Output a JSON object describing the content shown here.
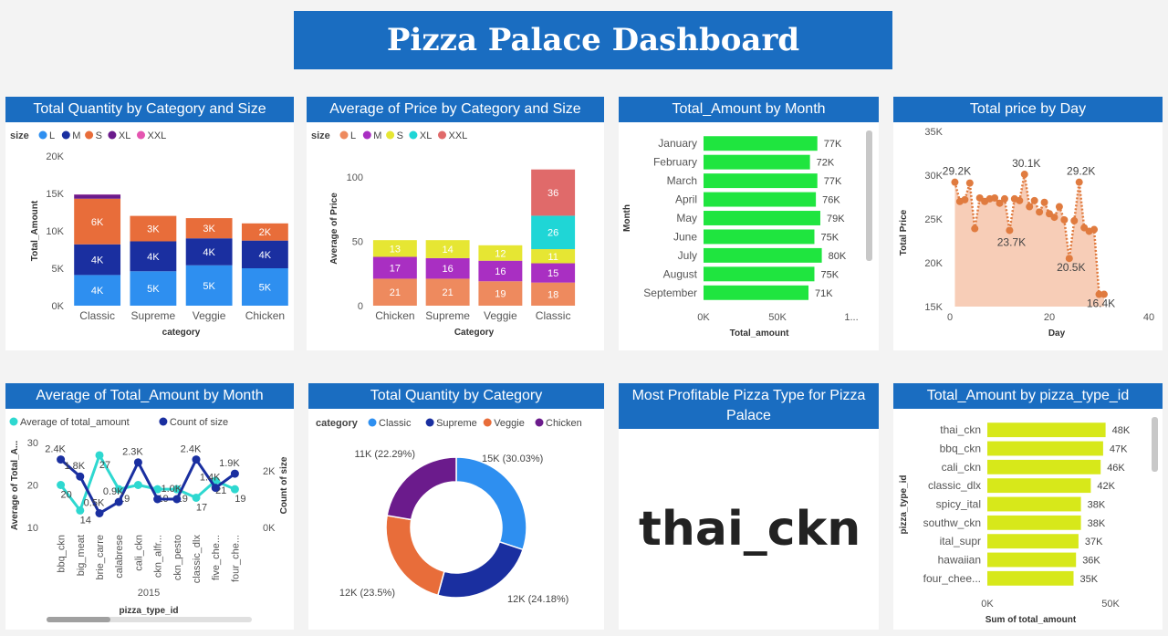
{
  "dashboard": {
    "title": "Pizza Palace Dashboard"
  },
  "panels": {
    "qty_cat_size": "Total Quantity by Category and Size",
    "avg_price": "Average of Price by Category and Size",
    "amount_month": "Total_Amount by Month",
    "price_day": "Total price by Day",
    "avg_amount_month": "Average of Total_Amount by Month",
    "qty_category": "Total Quantity by Category",
    "profitable": "Most Profitable Pizza Type for Pizza Palace",
    "amount_type": "Total_Amount by pizza_type_id"
  },
  "kpi": {
    "value": "thai_ckn"
  },
  "colors": {
    "header": "#1a6dc1"
  },
  "chart_data": [
    {
      "id": "c1",
      "type": "bar",
      "stacked": true,
      "categories": [
        "Classic",
        "Supreme",
        "Veggie",
        "Chicken"
      ],
      "xlabel": "category",
      "ylabel": "Total_Amount",
      "legend_title": "size",
      "ylim": [
        0,
        20000
      ],
      "yticks": [
        {
          "v": 0,
          "t": "0K"
        },
        {
          "v": 5000,
          "t": "5K"
        },
        {
          "v": 10000,
          "t": "10K"
        },
        {
          "v": 15000,
          "t": "15K"
        },
        {
          "v": 20000,
          "t": "20K"
        }
      ],
      "series": [
        {
          "name": "L",
          "color": "#2e8ff0",
          "values": [
            4100,
            4600,
            5400,
            5000
          ],
          "labels": [
            "4K",
            "5K",
            "5K",
            "5K"
          ]
        },
        {
          "name": "M",
          "color": "#1a2fa0",
          "values": [
            4100,
            4000,
            3600,
            3700
          ],
          "labels": [
            "4K",
            "4K",
            "4K",
            "4K"
          ]
        },
        {
          "name": "S",
          "color": "#e86d3a",
          "values": [
            6100,
            3400,
            2700,
            2300
          ],
          "labels": [
            "6K",
            "3K",
            "3K",
            "2K"
          ]
        },
        {
          "name": "XL",
          "color": "#6b1b8c",
          "values": [
            550,
            0,
            0,
            0
          ],
          "labels": [
            "",
            "",
            "",
            ""
          ]
        },
        {
          "name": "XXL",
          "color": "#e455b0",
          "values": [
            30,
            0,
            0,
            0
          ],
          "labels": [
            "",
            "",
            "",
            ""
          ]
        }
      ]
    },
    {
      "id": "c2",
      "type": "bar",
      "stacked": true,
      "categories": [
        "Chicken",
        "Supreme",
        "Veggie",
        "Classic"
      ],
      "xlabel": "Category",
      "ylabel": "Average of Price",
      "legend_title": "size",
      "ylim": [
        0,
        120
      ],
      "yticks": [
        {
          "v": 0,
          "t": "0"
        },
        {
          "v": 50,
          "t": "50"
        },
        {
          "v": 100,
          "t": "100"
        }
      ],
      "series": [
        {
          "name": "L",
          "color": "#ee8a5e",
          "values": [
            21,
            21,
            19,
            18
          ],
          "labels": [
            "21",
            "21",
            "19",
            "18"
          ]
        },
        {
          "name": "M",
          "color": "#a92fc2",
          "values": [
            17,
            16,
            16,
            15
          ],
          "labels": [
            "17",
            "16",
            "16",
            "15"
          ]
        },
        {
          "name": "S",
          "color": "#e6e633",
          "values": [
            13,
            14,
            12,
            11
          ],
          "labels": [
            "13",
            "14",
            "12",
            "11"
          ]
        },
        {
          "name": "XL",
          "color": "#1fd6d6",
          "values": [
            0,
            0,
            0,
            26
          ],
          "labels": [
            "",
            "",
            "",
            "26"
          ]
        },
        {
          "name": "XXL",
          "color": "#e06a6a",
          "values": [
            0,
            0,
            0,
            36
          ],
          "labels": [
            "",
            "",
            "",
            "36"
          ]
        }
      ]
    },
    {
      "id": "c3",
      "type": "bar",
      "orientation": "horizontal",
      "categories": [
        "January",
        "February",
        "March",
        "April",
        "May",
        "June",
        "July",
        "August",
        "September"
      ],
      "values": [
        77000,
        72000,
        77000,
        76000,
        79000,
        75000,
        80000,
        75000,
        71000
      ],
      "labels": [
        "77K",
        "72K",
        "77K",
        "76K",
        "79K",
        "75K",
        "80K",
        "75K",
        "71K"
      ],
      "xlabel": "Total_amount",
      "ylabel": "Month",
      "xlim": [
        0,
        100000
      ],
      "xticks": [
        {
          "v": 0,
          "t": "0K"
        },
        {
          "v": 50000,
          "t": "50K"
        },
        {
          "v": 100000,
          "t": "1..."
        }
      ],
      "color": "#1fe53f"
    },
    {
      "id": "c4",
      "type": "area",
      "x": [
        1,
        2,
        3,
        4,
        5,
        6,
        7,
        8,
        9,
        10,
        11,
        12,
        13,
        14,
        15,
        16,
        17,
        18,
        19,
        20,
        21,
        22,
        23,
        24,
        25,
        26,
        27,
        28,
        29,
        30,
        31
      ],
      "y": [
        29200,
        27000,
        27200,
        29100,
        23900,
        27400,
        27000,
        27300,
        27400,
        26800,
        27300,
        23700,
        27300,
        27100,
        30100,
        26400,
        27100,
        25800,
        26900,
        25600,
        25200,
        26400,
        24900,
        20500,
        24800,
        29200,
        24000,
        23600,
        23800,
        16400,
        16400
      ],
      "labels": [
        {
          "i": 0,
          "t": "29.2K"
        },
        {
          "i": 11,
          "t": "23.7K"
        },
        {
          "i": 14,
          "t": "30.1K"
        },
        {
          "i": 23,
          "t": "20.5K"
        },
        {
          "i": 25,
          "t": "29.2K"
        },
        {
          "i": 29,
          "t": "16.4K"
        }
      ],
      "xlabel": "Day",
      "ylabel": "Total Price",
      "xlim": [
        0,
        40
      ],
      "ylim": [
        15000,
        35000
      ],
      "xticks": [
        {
          "v": 0,
          "t": "0"
        },
        {
          "v": 20,
          "t": "20"
        },
        {
          "v": 40,
          "t": "40"
        }
      ],
      "yticks": [
        {
          "v": 15000,
          "t": "15K"
        },
        {
          "v": 20000,
          "t": "20K"
        },
        {
          "v": 25000,
          "t": "25K"
        },
        {
          "v": 30000,
          "t": "30K"
        },
        {
          "v": 35000,
          "t": "35K"
        }
      ],
      "color": "#e07b3f",
      "fill": "#f7cdb7"
    },
    {
      "id": "c5",
      "type": "line",
      "categories": [
        "bbq_ckn",
        "big_meat",
        "brie_carre",
        "calabrese",
        "cali_ckn",
        "ckn_alfr...",
        "ckn_pesto",
        "classic_dlx",
        "five_che...",
        "four_che..."
      ],
      "xlabel": "pizza_type_id",
      "xgroup": "2015",
      "ylabel": "Average of Total_A...",
      "y2label": "Count of size",
      "ylim": [
        10,
        30
      ],
      "y2lim": [
        0,
        3000
      ],
      "yticks": [
        {
          "v": 10,
          "t": "10"
        },
        {
          "v": 20,
          "t": "20"
        },
        {
          "v": 30,
          "t": "30"
        }
      ],
      "y2ticks": [
        {
          "v": 0,
          "t": "0K"
        },
        {
          "v": 2000,
          "t": "2K"
        }
      ],
      "series": [
        {
          "name": "Average of total_amount",
          "color": "#2ed8d0",
          "axis": "y",
          "values": [
            20,
            14,
            27,
            19,
            20,
            19,
            19,
            17,
            21,
            19
          ],
          "labels": [
            "20",
            "14",
            "27",
            "19",
            "",
            "19",
            "19",
            "17",
            "21",
            "19"
          ]
        },
        {
          "name": "Count of size",
          "color": "#1a2fa0",
          "axis": "y2",
          "values": [
            2400,
            1800,
            500,
            900,
            2300,
            1000,
            1000,
            2400,
            1400,
            1900
          ],
          "labels": [
            "2.4K",
            "1.8K",
            "0.5K",
            "0.9K",
            "2.3K",
            "",
            "1.0K",
            "2.4K",
            "1.4K",
            "1.9K"
          ]
        }
      ]
    },
    {
      "id": "c6",
      "type": "pie",
      "donut": true,
      "legend_title": "category",
      "categories": [
        "Classic",
        "Supreme",
        "Veggie",
        "Chicken"
      ],
      "values": [
        15000,
        12000,
        11700,
        11100
      ],
      "labels": [
        "15K (30.03%)",
        "12K (24.18%)",
        "12K (23.5%)",
        "11K (22.29%)"
      ],
      "colors": [
        "#2e8ff0",
        "#1a2fa0",
        "#e86d3a",
        "#6b1b8c"
      ]
    },
    {
      "id": "c7",
      "type": "bar",
      "orientation": "horizontal",
      "categories": [
        "thai_ckn",
        "bbq_ckn",
        "cali_ckn",
        "classic_dlx",
        "spicy_ital",
        "southw_ckn",
        "ital_supr",
        "hawaiian",
        "four_chee..."
      ],
      "values": [
        48000,
        47000,
        46000,
        42000,
        38000,
        38000,
        37000,
        36000,
        35000
      ],
      "labels": [
        "48K",
        "47K",
        "46K",
        "42K",
        "38K",
        "38K",
        "37K",
        "36K",
        "35K"
      ],
      "xlabel": "Sum of total_amount",
      "ylabel": "pizza_type_id",
      "xlim": [
        0,
        50000
      ],
      "xticks": [
        {
          "v": 0,
          "t": "0K"
        },
        {
          "v": 50000,
          "t": "50K"
        }
      ],
      "color": "#d7e81a"
    }
  ]
}
